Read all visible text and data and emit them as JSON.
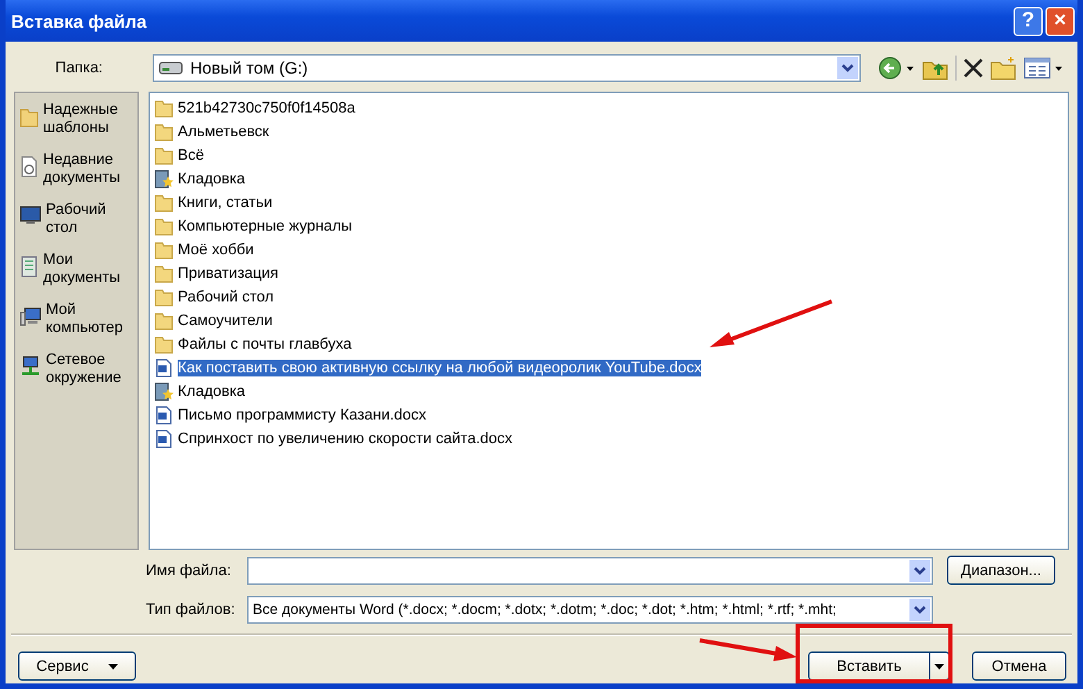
{
  "window": {
    "title": "Вставка файла",
    "help": "?",
    "close": "×"
  },
  "folder": {
    "label": "Папка:",
    "value": "Новый том (G:)"
  },
  "sidebar": {
    "items": [
      {
        "kind": "templates",
        "label": "Надежные шаблоны"
      },
      {
        "kind": "recent",
        "label": "Недавние документы"
      },
      {
        "kind": "desktop",
        "label": "Рабочий стол"
      },
      {
        "kind": "documents",
        "label": "Мои документы"
      },
      {
        "kind": "computer",
        "label": "Мой компьютер"
      },
      {
        "kind": "network",
        "label": "Сетевое окружение"
      }
    ]
  },
  "files": [
    {
      "kind": "folder",
      "name": "521b42730c750f0f14508a",
      "selected": false
    },
    {
      "kind": "folder",
      "name": "Альметьевск",
      "selected": false
    },
    {
      "kind": "folder",
      "name": "Всё",
      "selected": false
    },
    {
      "kind": "special",
      "name": "Кладовка",
      "selected": false
    },
    {
      "kind": "folder",
      "name": "Книги, статьи",
      "selected": false
    },
    {
      "kind": "folder",
      "name": "Компьютерные журналы",
      "selected": false
    },
    {
      "kind": "folder",
      "name": "Моё хобби",
      "selected": false
    },
    {
      "kind": "folder",
      "name": "Приватизация",
      "selected": false
    },
    {
      "kind": "folder",
      "name": "Рабочий стол",
      "selected": false
    },
    {
      "kind": "folder",
      "name": "Самоучители",
      "selected": false
    },
    {
      "kind": "folder",
      "name": "Файлы с почты главбуха",
      "selected": false
    },
    {
      "kind": "docx",
      "name": "Как поставить свою активную ссылку на любой видеоролик YouTube.docx",
      "selected": true
    },
    {
      "kind": "special",
      "name": "Кладовка",
      "selected": false
    },
    {
      "kind": "docx",
      "name": "Письмо программисту Казани.docx",
      "selected": false
    },
    {
      "kind": "docx",
      "name": "Спринхост по увеличению скорости сайта.docx",
      "selected": false
    }
  ],
  "file_name": {
    "label": "Имя файла:"
  },
  "file_type": {
    "label": "Тип файлов:",
    "value": "Все документы Word (*.docx; *.docm; *.dotx; *.dotm; *.doc; *.dot; *.htm; *.html; *.rtf; *.mht;"
  },
  "buttons": {
    "range": "Диапазон...",
    "tools": "Сервис",
    "insert": "Вставить",
    "cancel": "Отмена"
  }
}
